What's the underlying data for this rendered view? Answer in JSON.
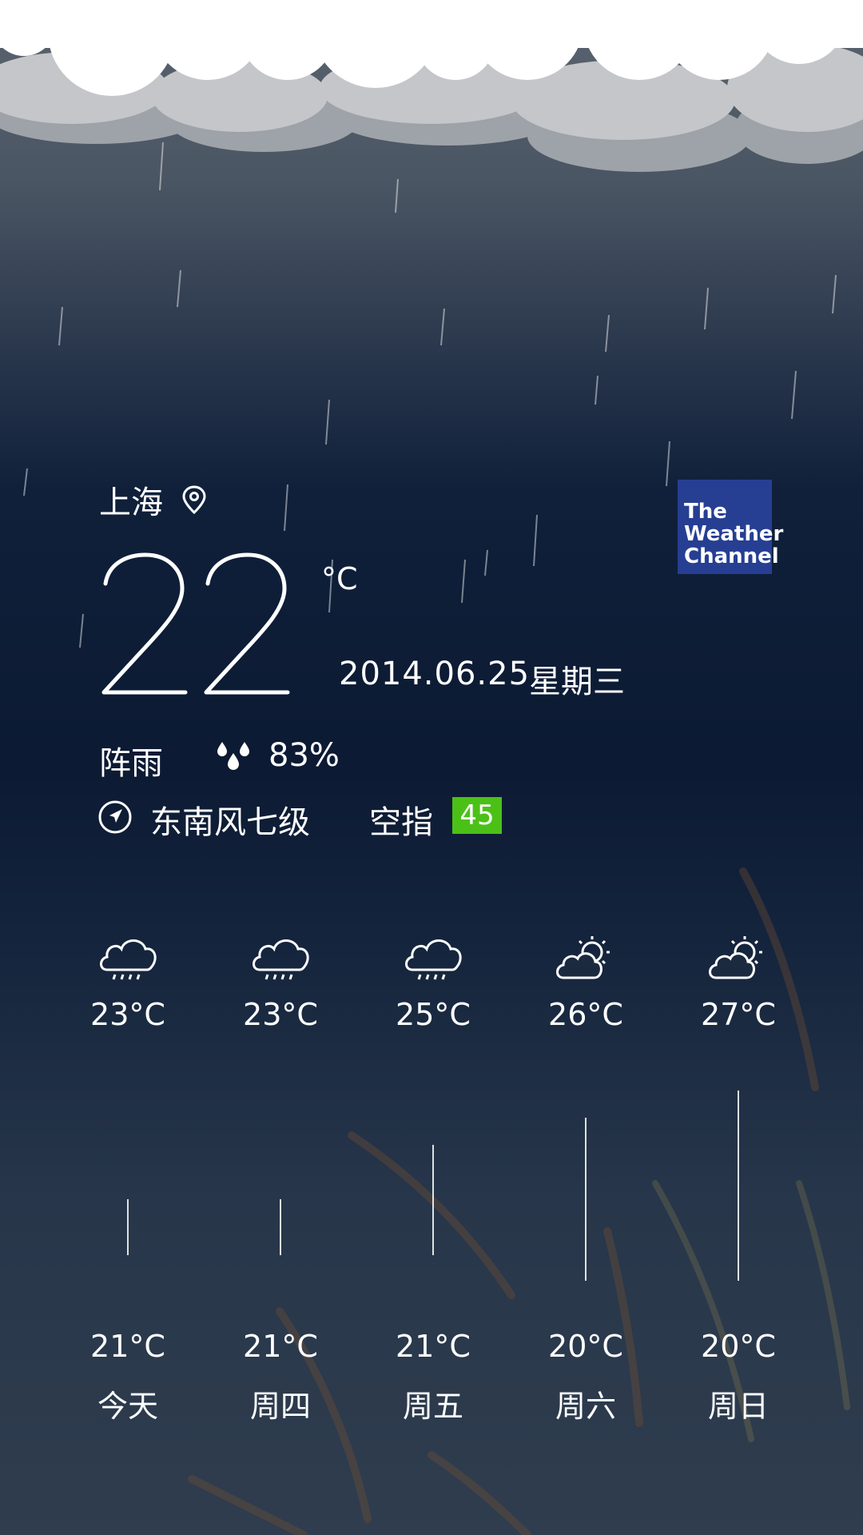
{
  "location": {
    "city": "上海",
    "pin_icon": "location-pin-icon"
  },
  "logo": {
    "line1": "The",
    "line2": "Weather",
    "line3": "Channel",
    "color": "#263f93"
  },
  "current": {
    "temperature": "22",
    "unit": "°C",
    "date": "2014.06.25",
    "weekday": "星期三",
    "condition": "阵雨",
    "humidity": "83%",
    "humidity_icon": "water-drops-icon",
    "wind_icon": "compass-navigation-icon",
    "wind": "东南风七级",
    "aqi_label": "空指",
    "aqi_value": "45",
    "aqi_color": "#4bc117"
  },
  "forecast": [
    {
      "day": "今天",
      "high": "23°C",
      "low": "21°C",
      "icon": "rain-cloud-icon"
    },
    {
      "day": "周四",
      "high": "23°C",
      "low": "21°C",
      "icon": "rain-cloud-icon"
    },
    {
      "day": "周五",
      "high": "25°C",
      "low": "21°C",
      "icon": "rain-cloud-icon"
    },
    {
      "day": "周六",
      "high": "26°C",
      "low": "20°C",
      "icon": "partly-sunny-icon"
    },
    {
      "day": "周日",
      "high": "27°C",
      "low": "20°C",
      "icon": "partly-sunny-icon"
    }
  ]
}
